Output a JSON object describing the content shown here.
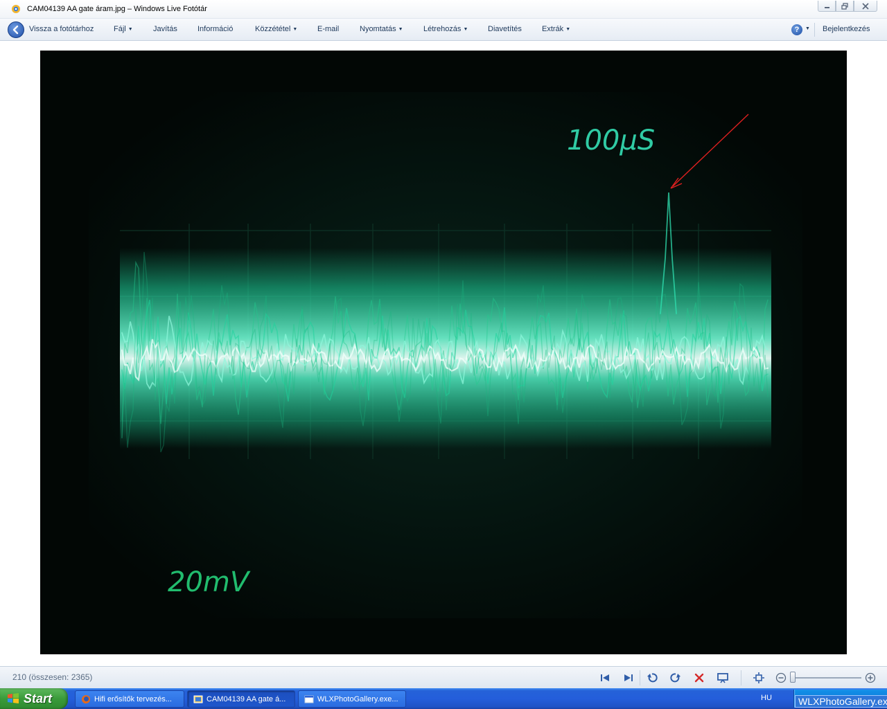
{
  "window": {
    "title": "CAM04139 AA gate áram.jpg – Windows Live Fotótár"
  },
  "toolbar": {
    "back_label": "Vissza a fotótárhoz",
    "items": [
      {
        "label": "Fájl",
        "has_menu": true
      },
      {
        "label": "Javítás",
        "has_menu": false
      },
      {
        "label": "Információ",
        "has_menu": false
      },
      {
        "label": "Közzététel",
        "has_menu": true
      },
      {
        "label": "E-mail",
        "has_menu": false
      },
      {
        "label": "Nyomtatás",
        "has_menu": true
      },
      {
        "label": "Létrehozás",
        "has_menu": true
      },
      {
        "label": "Diavetítés",
        "has_menu": false
      },
      {
        "label": "Extrák",
        "has_menu": true
      }
    ],
    "signin_label": "Bejelentkezés"
  },
  "photo": {
    "timebase_label": "100μS",
    "voltage_label": "20mV",
    "trace_color": "#2fe0b0",
    "annotation_arrow_color": "#e02020"
  },
  "statusbar": {
    "position_text": "210 (összesen: 2365)",
    "buttons": [
      "first-icon",
      "last-icon",
      "rotate-left-icon",
      "rotate-right-icon",
      "delete-icon",
      "slideshow-icon",
      "fit-icon",
      "zoom-out-icon",
      "zoom-in-icon"
    ]
  },
  "taskbar": {
    "start_label": "Start",
    "tasks": [
      {
        "label": "Hifi erősítők tervezés...",
        "icon": "firefox-icon",
        "active": false
      },
      {
        "label": "CAM04139 AA gate á...",
        "icon": "photo-gallery-icon",
        "active": true
      },
      {
        "label": "WLXPhotoGallery.exe...",
        "icon": "window-icon",
        "active": false
      }
    ],
    "language": "HU",
    "tray_tooltip": "WLXPhotoGallery.exe"
  },
  "colors": {
    "toolbar_text": "#1e395b",
    "taskbar_blue": "#245edb",
    "start_green": "#3a9b3a"
  }
}
